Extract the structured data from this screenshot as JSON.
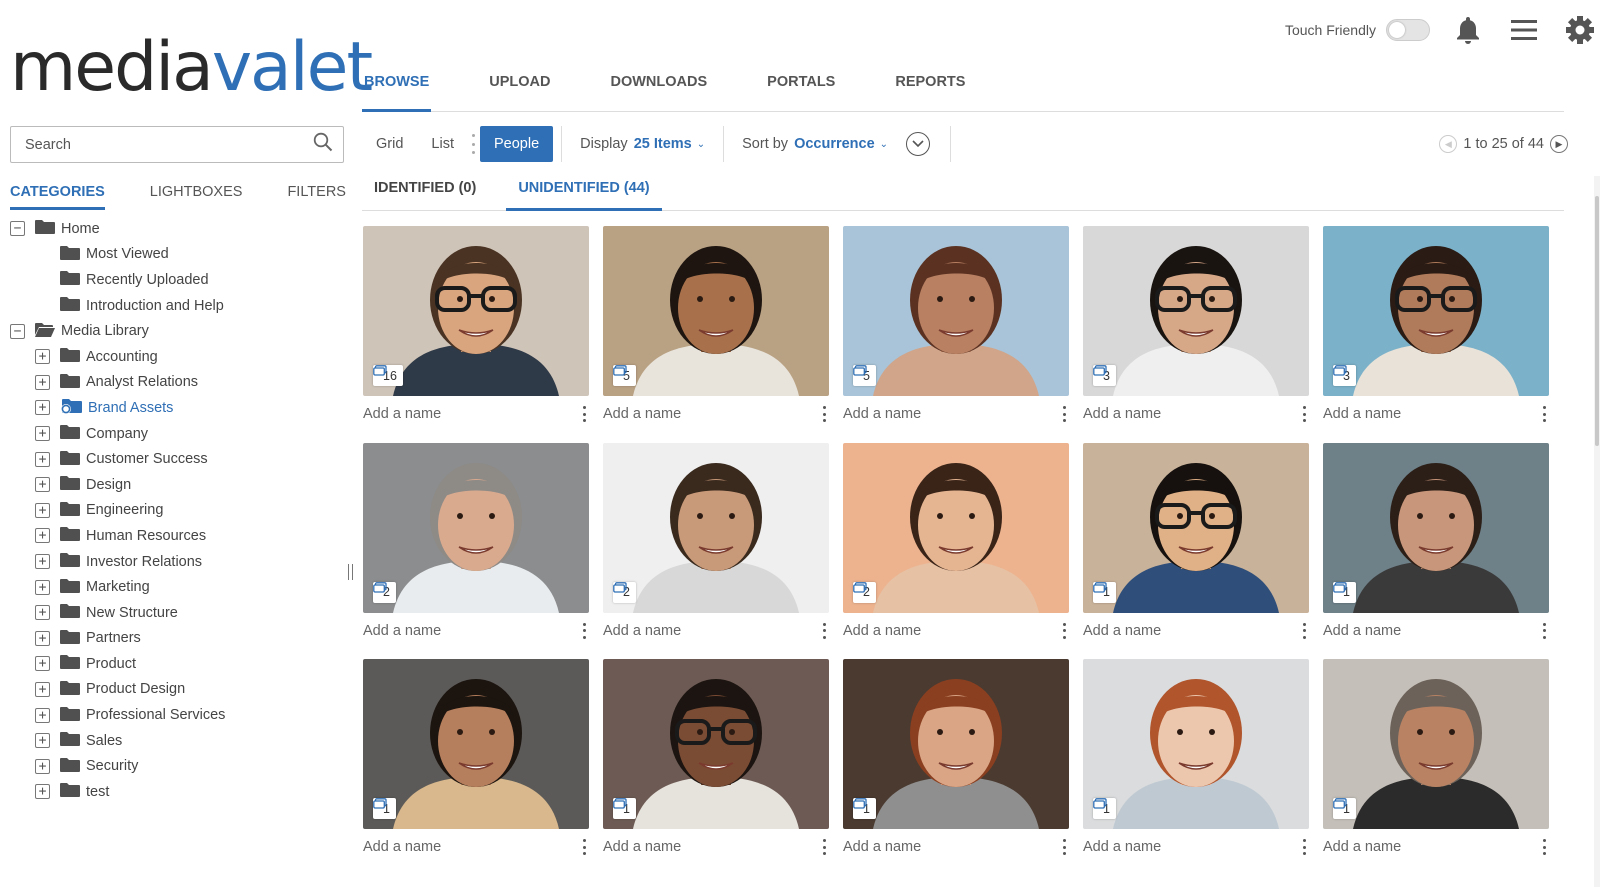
{
  "app": {
    "logo_part1": "media",
    "logo_part2": "valet"
  },
  "header": {
    "touch_friendly_label": "Touch Friendly",
    "touch_friendly_on": false
  },
  "nav": {
    "items": [
      "BROWSE",
      "UPLOAD",
      "DOWNLOADS",
      "PORTALS",
      "REPORTS"
    ],
    "active": "BROWSE"
  },
  "sidebar": {
    "search_placeholder": "Search",
    "tabs": [
      "CATEGORIES",
      "LIGHTBOXES",
      "FILTERS"
    ],
    "active_tab": "CATEGORIES",
    "tree": [
      {
        "label": "Home",
        "level": 1,
        "expander": "−",
        "folder": "closed"
      },
      {
        "label": "Most Viewed",
        "level": 2,
        "expander": "",
        "folder": "closed"
      },
      {
        "label": "Recently Uploaded",
        "level": 2,
        "expander": "",
        "folder": "closed"
      },
      {
        "label": "Introduction and Help",
        "level": 2,
        "expander": "",
        "folder": "closed"
      },
      {
        "label": "Media Library",
        "level": 1,
        "expander": "−",
        "folder": "open"
      },
      {
        "label": "Accounting",
        "level": 2,
        "expander": "+",
        "folder": "closed"
      },
      {
        "label": "Analyst Relations",
        "level": 2,
        "expander": "+",
        "folder": "closed"
      },
      {
        "label": "Brand Assets",
        "level": 2,
        "expander": "+",
        "folder": "linked"
      },
      {
        "label": "Company",
        "level": 2,
        "expander": "+",
        "folder": "closed"
      },
      {
        "label": "Customer Success",
        "level": 2,
        "expander": "+",
        "folder": "closed"
      },
      {
        "label": "Design",
        "level": 2,
        "expander": "+",
        "folder": "closed"
      },
      {
        "label": "Engineering",
        "level": 2,
        "expander": "+",
        "folder": "closed"
      },
      {
        "label": "Human Resources",
        "level": 2,
        "expander": "+",
        "folder": "closed"
      },
      {
        "label": "Investor Relations",
        "level": 2,
        "expander": "+",
        "folder": "closed"
      },
      {
        "label": "Marketing",
        "level": 2,
        "expander": "+",
        "folder": "closed"
      },
      {
        "label": "New Structure",
        "level": 2,
        "expander": "+",
        "folder": "closed"
      },
      {
        "label": "Partners",
        "level": 2,
        "expander": "+",
        "folder": "closed"
      },
      {
        "label": "Product",
        "level": 2,
        "expander": "+",
        "folder": "closed"
      },
      {
        "label": "Product Design",
        "level": 2,
        "expander": "+",
        "folder": "closed"
      },
      {
        "label": "Professional Services",
        "level": 2,
        "expander": "+",
        "folder": "closed"
      },
      {
        "label": "Sales",
        "level": 2,
        "expander": "+",
        "folder": "closed"
      },
      {
        "label": "Security",
        "level": 2,
        "expander": "+",
        "folder": "closed"
      },
      {
        "label": "test",
        "level": 2,
        "expander": "+",
        "folder": "closed"
      }
    ]
  },
  "toolbar": {
    "view_grid": "Grid",
    "view_list": "List",
    "view_people": "People",
    "display_label": "Display",
    "display_value": "25 Items",
    "sort_label": "Sort by",
    "sort_value": "Occurrence",
    "pager_text": "1 to 25 of 44"
  },
  "people_tabs": {
    "identified": "IDENTIFIED (0)",
    "unidentified": "UNIDENTIFIED (44)",
    "active": "UNIDENTIFIED (44)"
  },
  "people": [
    {
      "count": "16",
      "name_placeholder": "Add a name",
      "bg": "#cfc4b8",
      "skin": "#d9a57f",
      "hair": "#4a3322",
      "glasses": true,
      "shirt": "#2f3a48"
    },
    {
      "count": "5",
      "name_placeholder": "Add a name",
      "bg": "#b9a183",
      "skin": "#a8714c",
      "hair": "#1e1510",
      "glasses": false,
      "shirt": "#e8e4dc"
    },
    {
      "count": "5",
      "name_placeholder": "Add a name",
      "bg": "#a9c4d8",
      "skin": "#b98062",
      "hair": "#5b3222",
      "glasses": false,
      "shirt": "#d0a58a"
    },
    {
      "count": "3",
      "name_placeholder": "Add a name",
      "bg": "#d8d8d8",
      "skin": "#d7a888",
      "hair": "#1a1410",
      "glasses": true,
      "shirt": "#efefef"
    },
    {
      "count": "3",
      "name_placeholder": "Add a name",
      "bg": "#7bb1c9",
      "skin": "#b07b5b",
      "hair": "#2a1b14",
      "glasses": true,
      "shirt": "#e9e2d8"
    },
    {
      "count": "2",
      "name_placeholder": "Add a name",
      "bg": "#8b8d8e",
      "skin": "#d9aa8e",
      "hair": "#8e8a86",
      "glasses": false,
      "shirt": "#e9ecef"
    },
    {
      "count": "2",
      "name_placeholder": "Add a name",
      "bg": "#efefef",
      "skin": "#c99a79",
      "hair": "#3a2a1e",
      "glasses": false,
      "shirt": "#d8d8d8"
    },
    {
      "count": "2",
      "name_placeholder": "Add a name",
      "bg": "#edb38f",
      "skin": "#e5b592",
      "hair": "#3a2418",
      "glasses": false,
      "shirt": "#e6c1a4"
    },
    {
      "count": "1",
      "name_placeholder": "Add a name",
      "bg": "#c9b29a",
      "skin": "#e0b086",
      "hair": "#16110e",
      "glasses": true,
      "shirt": "#2f4f7a"
    },
    {
      "count": "1",
      "name_placeholder": "Add a name",
      "bg": "#6e8088",
      "skin": "#c8967a",
      "hair": "#2c1f18",
      "glasses": false,
      "shirt": "#3a3a3a"
    },
    {
      "count": "1",
      "name_placeholder": "Add a name",
      "bg": "#5c5a58",
      "skin": "#b57e5c",
      "hair": "#1b140f",
      "glasses": false,
      "shirt": "#d8b88c"
    },
    {
      "count": "1",
      "name_placeholder": "Add a name",
      "bg": "#6d5a54",
      "skin": "#7a4c34",
      "hair": "#1c1410",
      "glasses": true,
      "shirt": "#e6e2dc"
    },
    {
      "count": "1",
      "name_placeholder": "Add a name",
      "bg": "#4a3a30",
      "skin": "#d9a585",
      "hair": "#8a3f20",
      "glasses": false,
      "shirt": "#8f8f8f"
    },
    {
      "count": "1",
      "name_placeholder": "Add a name",
      "bg": "#dadcdd",
      "skin": "#edc7ad",
      "hair": "#b0552c",
      "glasses": false,
      "shirt": "#bfc9d2"
    },
    {
      "count": "1",
      "name_placeholder": "Add a name",
      "bg": "#c4bfb8",
      "skin": "#b98363",
      "hair": "#6c625a",
      "glasses": false,
      "shirt": "#2b2b2b"
    }
  ],
  "colors": {
    "accent": "#2f6fb5",
    "text": "#333333",
    "muted": "#555555"
  }
}
